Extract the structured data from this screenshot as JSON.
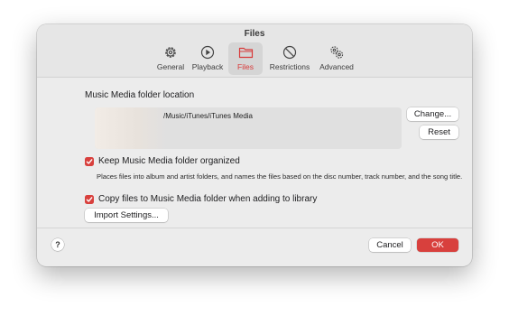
{
  "window": {
    "title": "Files"
  },
  "tabs": [
    {
      "label": "General",
      "icon": "gear-icon"
    },
    {
      "label": "Playback",
      "icon": "play-icon"
    },
    {
      "label": "Files",
      "icon": "folder-icon",
      "selected": true
    },
    {
      "label": "Restrictions",
      "icon": "restricted-icon"
    },
    {
      "label": "Advanced",
      "icon": "gears-icon"
    }
  ],
  "media_folder": {
    "label": "Music Media folder location",
    "path": "/Music/iTunes/iTunes Media",
    "change_button": "Change...",
    "reset_button": "Reset"
  },
  "options": {
    "keep_organized": {
      "label": "Keep Music Media folder organized",
      "checked": true,
      "description": "Places files into album and artist folders, and names the files based on the disc number, track number, and the song title."
    },
    "copy_files": {
      "label": "Copy files to Music Media folder when adding to library",
      "checked": true
    }
  },
  "import_button": "Import Settings...",
  "footer": {
    "help": "?",
    "cancel": "Cancel",
    "ok": "OK"
  },
  "colors": {
    "accent": "#d8403d",
    "window_bg": "#ececec",
    "toolbar_bg": "#e6e6e6"
  }
}
